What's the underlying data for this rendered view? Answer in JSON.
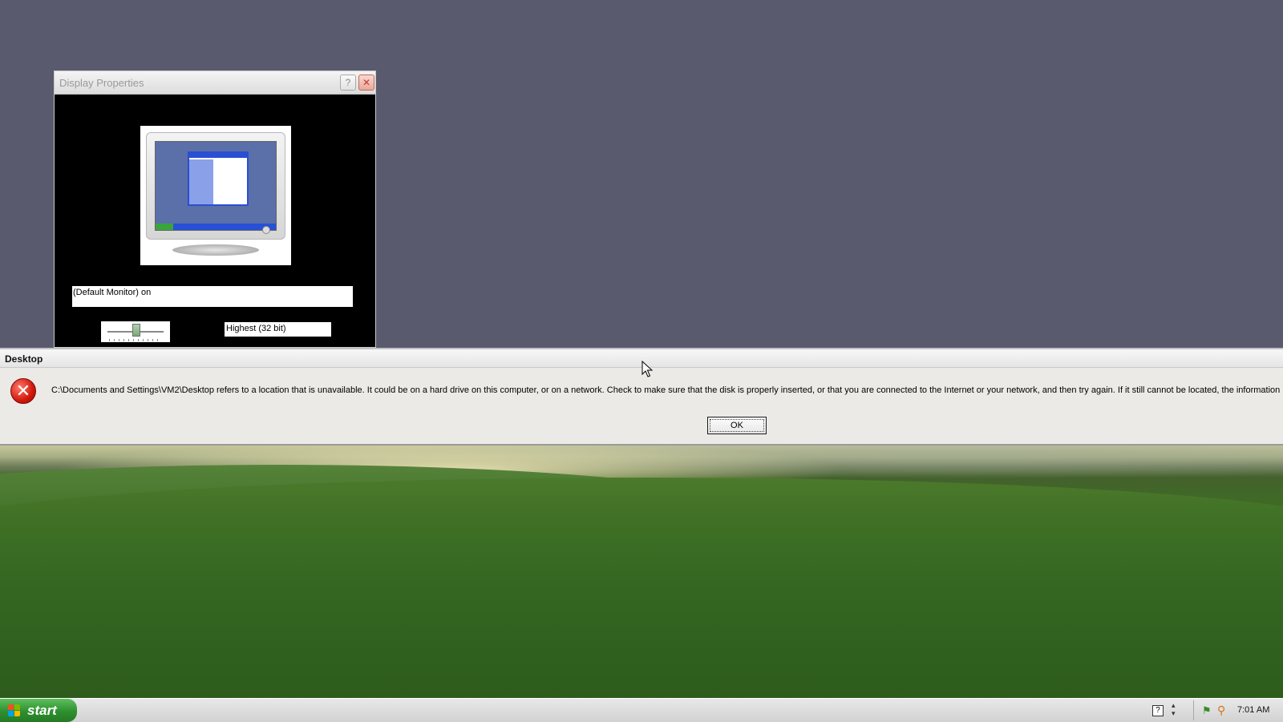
{
  "display_properties": {
    "title": "Display Properties",
    "help_button": "?",
    "close_button": "✕",
    "monitor_label": "(Default Monitor) on",
    "color_quality": "Highest (32 bit)"
  },
  "error_dialog": {
    "title": "Desktop",
    "icon_glyph": "✕",
    "message": "C:\\Documents and Settings\\VM2\\Desktop refers to a location that is unavailable. It could be on a hard drive on this computer, or on a network. Check to make sure that the disk is properly inserted, or that you are connected to the Internet or your network, and then try again. If it still cannot be located, the information",
    "ok_label": "OK"
  },
  "taskbar": {
    "start_label": "start",
    "help_glyph": "?",
    "clock": "7:01 AM"
  },
  "icons": {
    "start": "windows-flag-icon",
    "tray": [
      "help-icon",
      "updown-arrows-icon",
      "network-icon",
      "search-icon"
    ],
    "error": "error-icon"
  }
}
